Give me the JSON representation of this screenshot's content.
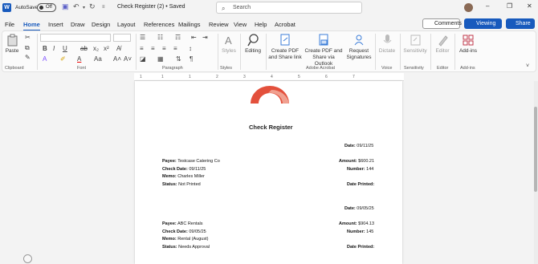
{
  "titlebar": {
    "autosave": "AutoSave",
    "toggle": "Off",
    "document": "Check Register (2) • Saved",
    "search_placeholder": "Search"
  },
  "menu": [
    "File",
    "Home",
    "Insert",
    "Draw",
    "Design",
    "Layout",
    "References",
    "Mailings",
    "Review",
    "View",
    "Help",
    "Acrobat"
  ],
  "buttons": {
    "comments": "Comments",
    "viewing": "Viewing",
    "share": "Share"
  },
  "ribbon": {
    "groups": {
      "clipboard": "Clipboard",
      "font": "Font",
      "paragraph": "Paragraph",
      "styles": "Styles",
      "adobe": "Adobe Acrobat",
      "voice": "Voice",
      "sensitivity": "Sensitivity",
      "editor": "Editor",
      "addins": "Add-ins"
    },
    "paste": "Paste",
    "styles": "Styles",
    "editing": "Editing",
    "create_pdf_share": "Create PDF and Share link",
    "create_pdf_outlook": "Create PDF and Share via Outlook",
    "request_signatures": "Request Signatures",
    "dictate": "Dictate",
    "sensitivity": "Sensitivity",
    "editor": "Editor",
    "addins": "Add-ins"
  },
  "ruler": [
    "1",
    "2",
    "1",
    "1",
    "2",
    "3",
    "4",
    "5",
    "6",
    "7"
  ],
  "document": {
    "title": "Check Register",
    "checks": [
      {
        "date_label": "Date:",
        "date": "09/11/25",
        "payee_label": "Payee:",
        "payee": "Testcase Catering Co",
        "check_date_label": "Check Date:",
        "check_date": "09/11/25",
        "memo_label": "Memo:",
        "memo": "Charles Miller",
        "status_label": "Status:",
        "status": "Not Printed",
        "amount_label": "Amount:",
        "amount": "$600.21",
        "number_label": "Number:",
        "number": "144",
        "date_printed_label": "Date Printed:"
      },
      {
        "date_label": "Date:",
        "date": "09/05/25",
        "payee_label": "Payee:",
        "payee": "ABC Rentals",
        "check_date_label": "Check Date:",
        "check_date": "09/05/25",
        "memo_label": "Memo:",
        "memo": "Rental (August)",
        "status_label": "Status:",
        "status": "Needs Approval",
        "amount_label": "Amount:",
        "amount": "$904.13",
        "number_label": "Number:",
        "number": "145",
        "date_printed_label": "Date Printed:"
      }
    ]
  },
  "colors": {
    "accent": "#185abd",
    "logo_dark": "#e3503c",
    "logo_light": "#f0a090"
  }
}
